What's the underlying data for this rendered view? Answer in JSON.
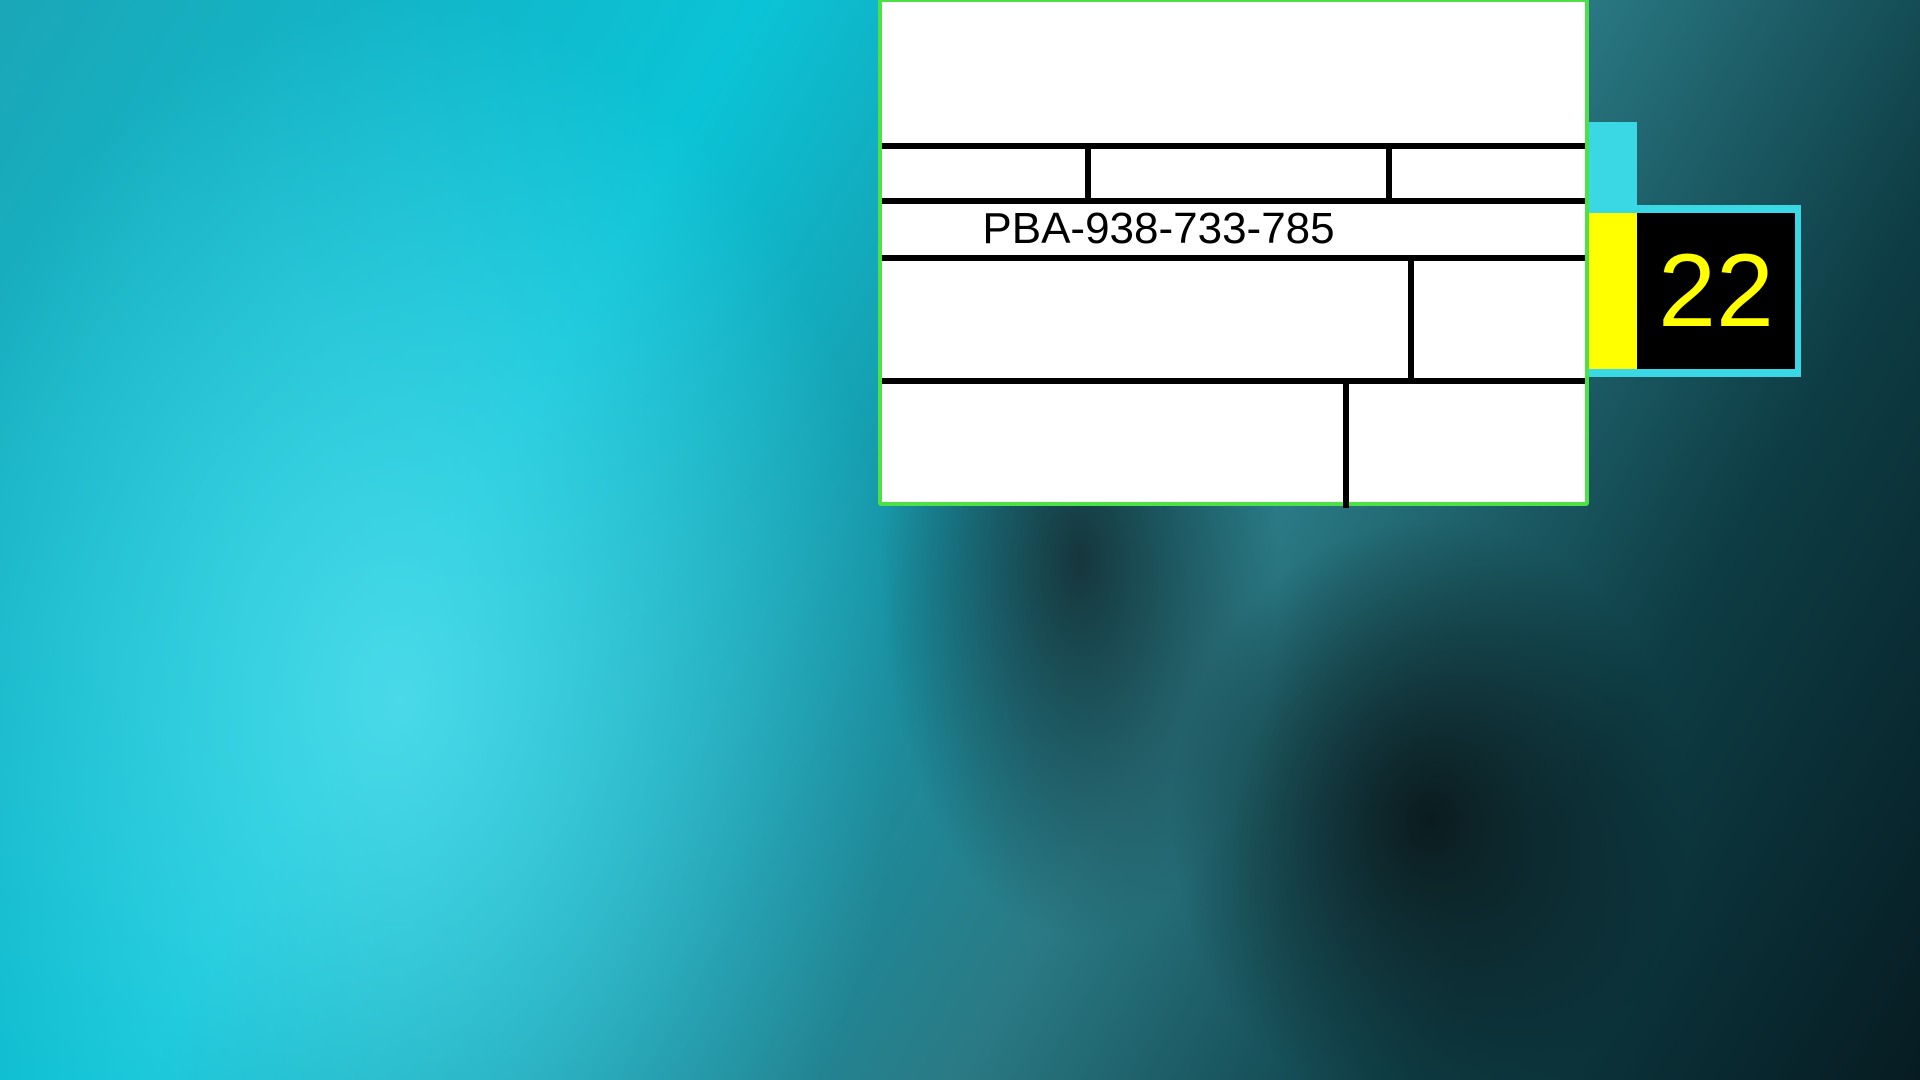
{
  "label": {
    "code": "PBA-938-733-785"
  },
  "badge": {
    "number": "22"
  },
  "colors": {
    "panel_border": "#4ee047",
    "badge_accent": "#ffff00",
    "badge_frame": "#3ad8e4"
  }
}
